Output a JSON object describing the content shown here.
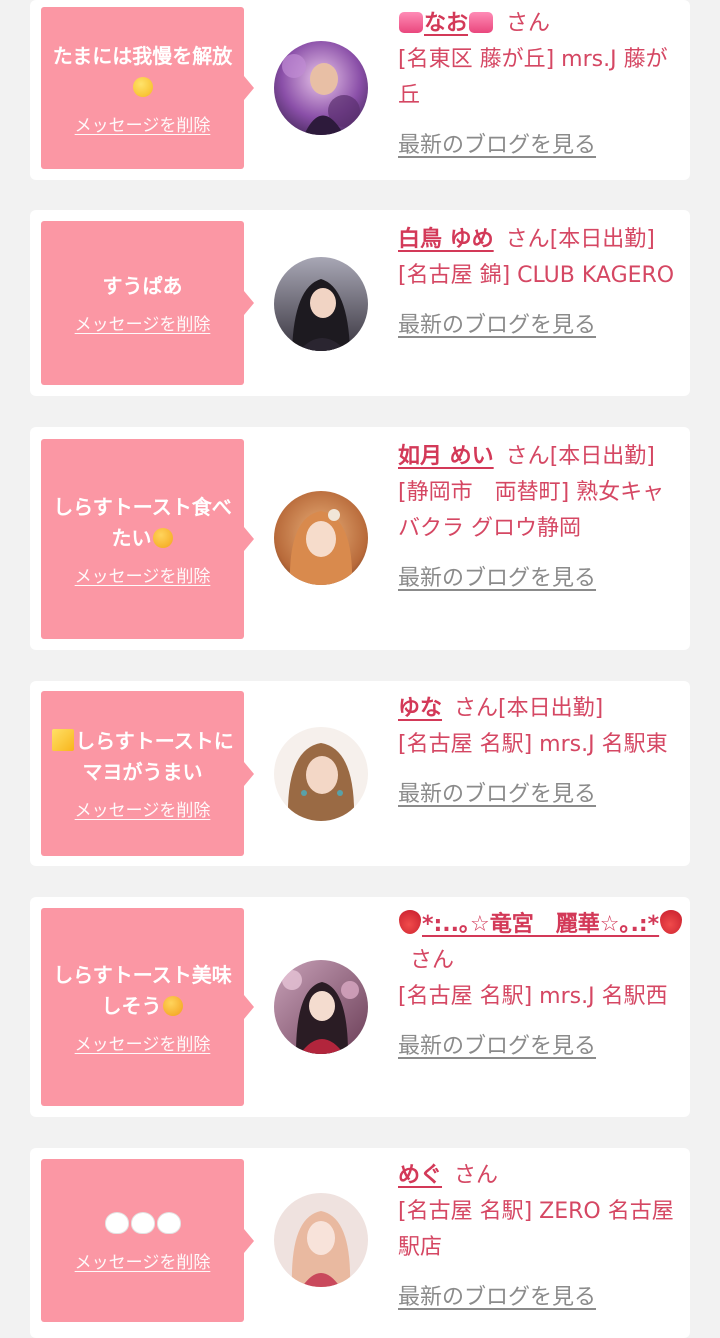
{
  "strings": {
    "delete_label": "メッセージを削除",
    "blog_label": "最新のブログを見る",
    "san": "さん"
  },
  "colors": {
    "background": "#f2f2f2",
    "bubble": "#fb97a4",
    "name": "#d33958",
    "text": "#d54763",
    "blog_link": "#8b8b8b"
  },
  "entries": [
    {
      "message": "たまには我慢を解放",
      "message_emoji": "smiling-face-icon",
      "name_prefix_emoji": "heart-gift-icon",
      "name": "なお",
      "name_suffix_emoji": "heart-gift-icon",
      "status": "",
      "shop": "[名東区 藤が丘] mrs.J 藤が丘"
    },
    {
      "message": "すうぱあ",
      "message_emoji": "",
      "name_prefix_emoji": "",
      "name": "白鳥 ゆめ",
      "name_suffix_emoji": "",
      "status": "[本日出勤]",
      "shop": "[名古屋 錦] CLUB KAGERO"
    },
    {
      "message": "しらすトースト食べたい",
      "message_emoji": "heart-eyes-face-icon",
      "name_prefix_emoji": "",
      "name": "如月 めい",
      "name_suffix_emoji": "",
      "status": "[本日出勤]",
      "shop": "[静岡市　両替町] 熟女キャバクラ グロウ静岡"
    },
    {
      "message": "しらすトーストにマヨがうまい",
      "message_emoji_prefix": "sparkles-icon",
      "name_prefix_emoji": "",
      "name": "ゆな",
      "name_suffix_emoji": "",
      "status": "[本日出勤]",
      "shop": "[名古屋 名駅] mrs.J 名駅東"
    },
    {
      "message": "しらすトースト美味しそう",
      "message_emoji": "smiling-face-with-hearts-icon",
      "name_prefix_emoji": "strawberry-icon",
      "name": "*:..｡☆竜宮　麗華☆｡.:*",
      "name_suffix_emoji": "strawberry-icon",
      "status": "",
      "shop": "[名古屋 名駅] mrs.J 名駅西"
    },
    {
      "message": "",
      "message_emoji": "white-heart-icon",
      "message_emoji_count": 3,
      "name_prefix_emoji": "",
      "name": "めぐ",
      "name_suffix_emoji": "",
      "status": "",
      "shop": "[名古屋 名駅] ZERO 名古屋駅店"
    }
  ]
}
